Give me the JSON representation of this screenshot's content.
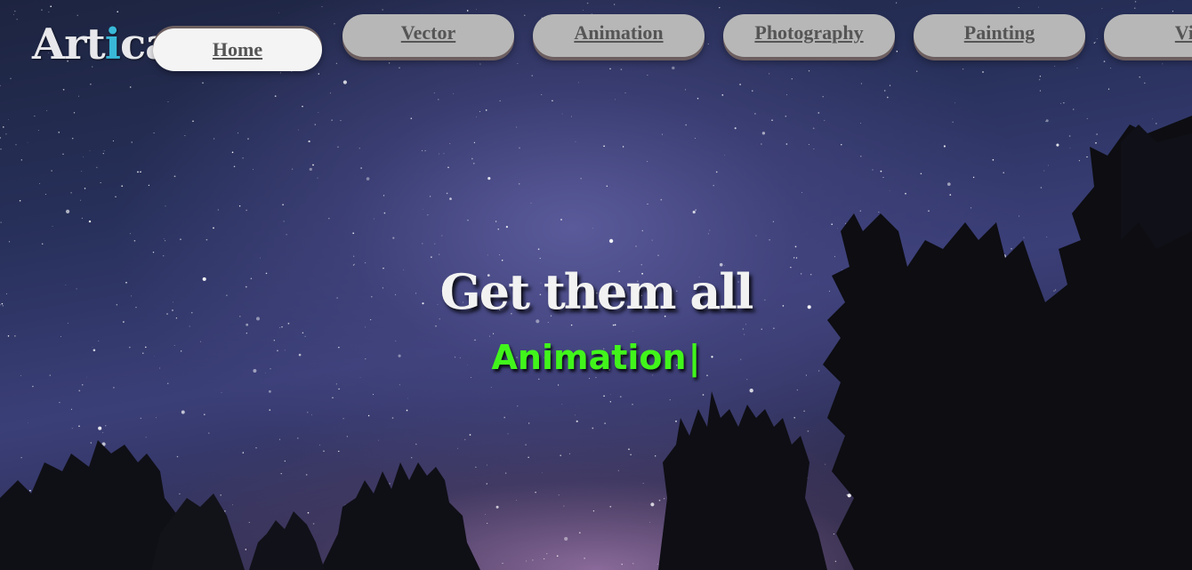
{
  "logo": {
    "text_main": "Art",
    "text_accent": "i",
    "text_tail": "ca",
    "accent_color": "#39b8d8"
  },
  "nav": {
    "items": [
      {
        "label": "Home",
        "active": true
      },
      {
        "label": "Vector",
        "active": false
      },
      {
        "label": "Animation",
        "active": false
      },
      {
        "label": "Photography",
        "active": false
      },
      {
        "label": "Painting",
        "active": false
      },
      {
        "label": "Vid",
        "active": false
      }
    ]
  },
  "hero": {
    "title": "Get them all",
    "rotating_word": "Animation",
    "cursor": "|",
    "rotating_word_color": "#41f51b"
  }
}
